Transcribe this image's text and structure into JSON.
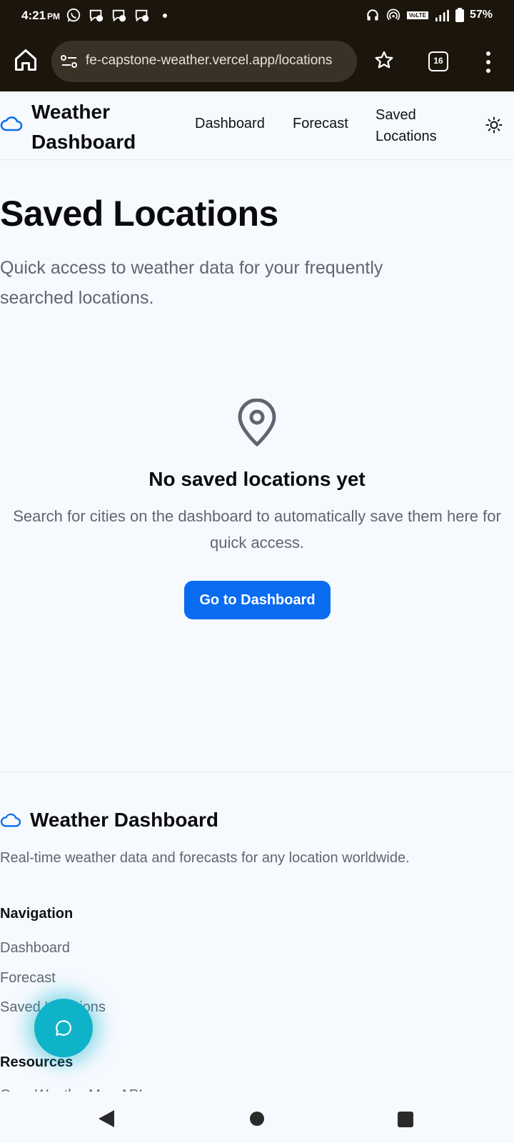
{
  "status_bar": {
    "time": "4:21",
    "ampm": "PM",
    "battery_pct": "57%",
    "volte": "VoLTE"
  },
  "browser": {
    "url": "fe-capstone-weather.vercel.app/locations",
    "tab_count": "16",
    "icons": [
      "home-icon",
      "site-settings-icon",
      "star-icon",
      "tabs-icon",
      "more-vert-icon"
    ]
  },
  "header": {
    "brand": "Weather Dashboard",
    "nav": {
      "dashboard": "Dashboard",
      "forecast": "Forecast",
      "saved": "Saved Locations"
    },
    "theme_icon": "sun-icon"
  },
  "main": {
    "title": "Saved Locations",
    "subtitle": "Quick access to weather data for your frequently searched locations.",
    "empty": {
      "icon": "map-pin-icon",
      "title": "No saved locations yet",
      "description": "Search for cities on the dashboard to automatically save them here for quick access.",
      "cta": "Go to Dashboard"
    }
  },
  "footer": {
    "brand": "Weather Dashboard",
    "description": "Real-time weather data and forecasts for any location worldwide.",
    "navigation_heading": "Navigation",
    "nav_links": [
      "Dashboard",
      "Forecast",
      "Saved Locations"
    ],
    "resources_heading": "Resources",
    "resource_links": [
      "OpenWeatherMap API"
    ]
  },
  "colors": {
    "accent": "#0a6cf0",
    "chat_fab": "#0fb3c9",
    "background": "#f6faff",
    "browser_chrome": "#1b150c"
  }
}
